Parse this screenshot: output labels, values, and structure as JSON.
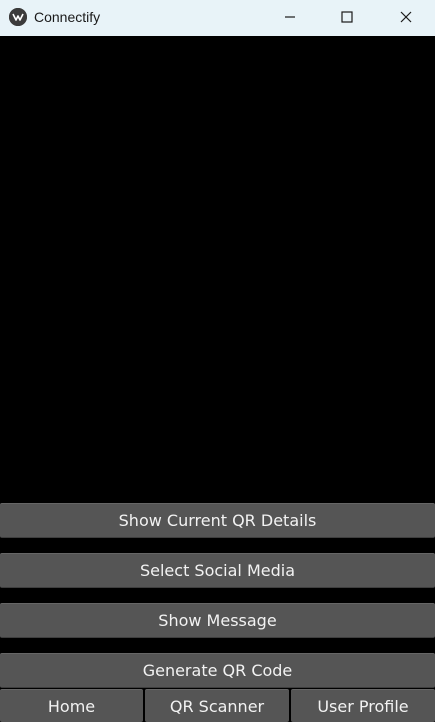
{
  "window": {
    "title": "Connectify",
    "app_icon": "kivy-logo-icon",
    "controls": [
      "minimize-icon",
      "maximize-icon",
      "close-icon"
    ]
  },
  "camera_view": {
    "background": "#000000"
  },
  "actions": {
    "show_details": "Show Current QR Details",
    "select_social": "Select Social Media",
    "show_message": "Show Message",
    "generate_qr": "Generate QR Code"
  },
  "nav": {
    "home": "Home",
    "qr_scanner": "QR Scanner",
    "user_profile": "User Profile"
  },
  "colors": {
    "button_bg": "#555555",
    "button_text": "#f2f2f2",
    "titlebar_bg": "#e8f3f8"
  }
}
